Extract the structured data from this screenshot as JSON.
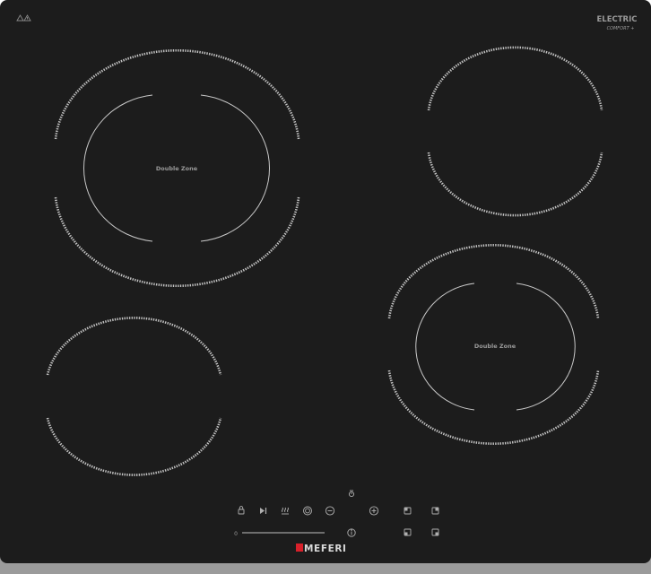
{
  "brand": {
    "name": "MEFERI",
    "series": "ELECTRIC",
    "series_sub": "COMFORT +",
    "accent_color": "#d8202a"
  },
  "zones": {
    "front_left_label": "Double Zone",
    "rear_right_label": "Double Zone"
  },
  "controls": {
    "slider_min_label": "0",
    "icons": [
      "lock-icon",
      "play-pause-icon",
      "keep-warm-icon",
      "dual-zone-icon",
      "minus-icon",
      "plus-icon",
      "timer-icon",
      "info-icon",
      "zone-select-front-left-icon",
      "zone-select-front-right-icon",
      "zone-select-rear-left-icon",
      "zone-select-rear-right-icon"
    ]
  },
  "warning_icons": [
    "hot-surface-warning-icon",
    "warning-triangle-icon"
  ],
  "colors": {
    "glass": "#1c1c1c",
    "frame": "#9b9b9b",
    "marking": "#bdbdbd"
  }
}
